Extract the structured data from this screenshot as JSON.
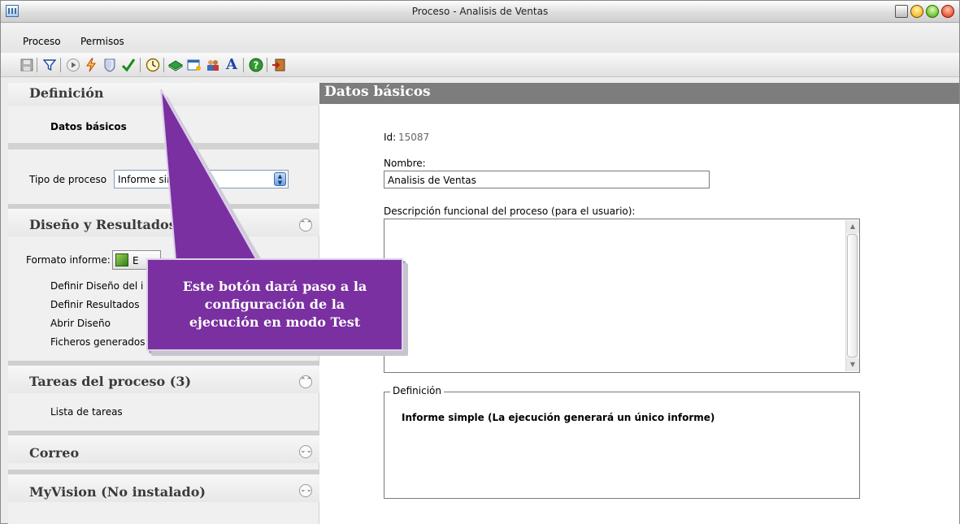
{
  "window": {
    "title": "Proceso - Analisis de Ventas"
  },
  "menu": {
    "items": [
      "Proceso",
      "Permisos"
    ]
  },
  "toolbar": {
    "icons": [
      "save-icon",
      "filter-icon",
      "run-icon",
      "lightning-icon",
      "shield-icon",
      "check-icon",
      "clock-icon",
      "book-icon",
      "window-icon",
      "people-icon",
      "font-icon",
      "help-icon",
      "exit-icon"
    ]
  },
  "left": {
    "definicion": {
      "header": "Definición",
      "datos_basicos": "Datos básicos",
      "tipo_label": "Tipo de proceso",
      "tipo_value": "Informe sin"
    },
    "diseno": {
      "header": "Diseño y Resultados",
      "formato_label": "Formato informe:",
      "formato_value": "E",
      "links": [
        "Definir Diseño del i",
        "Definir Resultados",
        "Abrir Diseño",
        "Ficheros generados"
      ]
    },
    "tareas": {
      "header": "Tareas del proceso (3)",
      "lista": "Lista de tareas"
    },
    "correo": {
      "header": "Correo"
    },
    "myvision": {
      "header": "MyVision (No instalado)"
    }
  },
  "right": {
    "header": "Datos básicos",
    "id_label": "Id:",
    "id_value": "15087",
    "nombre_label": "Nombre:",
    "nombre_value": "Analisis de Ventas",
    "descripcion_label": "Descripción funcional del proceso (para el usuario):",
    "descripcion_value": "",
    "definicion_legend": "Definición",
    "definicion_text": "Informe simple (La ejecución generará un único informe)"
  },
  "callout": {
    "text": "Este botón dará paso a la\nconfiguración de la\nejecución en modo Test"
  },
  "colors": {
    "callout_bg": "#7a30a0",
    "header_bg": "#7d7d7d"
  }
}
